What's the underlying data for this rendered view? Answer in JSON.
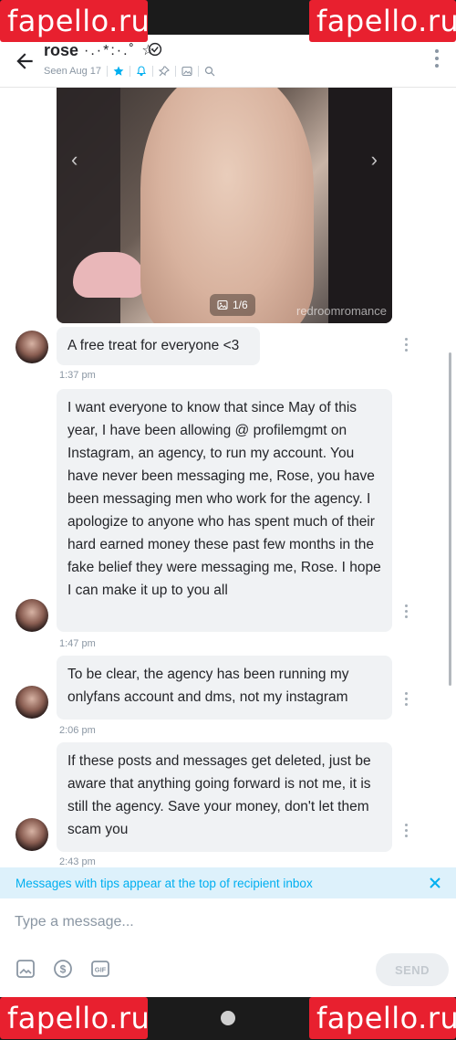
{
  "watermark": "fapello.ru",
  "header": {
    "name": "rose",
    "name_decoration": "·.·*:·.˚ ☆",
    "seen": "Seen Aug 17"
  },
  "media": {
    "counter": "1/6",
    "image_watermark": "redroomromance"
  },
  "messages": [
    {
      "text": "A free treat for everyone <3",
      "time": "1:37 pm"
    },
    {
      "text": "I want everyone to know that since May of this year, I have been allowing @ profilemgmt on Instagram, an agency, to run my account. You have never been messaging me, Rose, you have been messaging men who work for the agency. I apologize to anyone who has spent much of their hard earned money these past few months in the fake belief they were messaging me, Rose. I hope I can make it up to you all",
      "time": "1:47 pm"
    },
    {
      "text": "To be clear, the agency has been running my onlyfans account and dms, not my instagram",
      "time": "2:06 pm"
    },
    {
      "text": "If these posts and messages get deleted, just be aware that anything going forward is not me, it is still the agency. Save your money, don't let them scam you",
      "time": "2:43 pm"
    }
  ],
  "tips_banner": "Messages with tips appear at the top of recipient inbox",
  "composer": {
    "placeholder": "Type a message...",
    "send_label": "SEND"
  },
  "colors": {
    "accent": "#00aff0",
    "watermark": "#e8202f",
    "bubble": "#f0f2f4"
  }
}
